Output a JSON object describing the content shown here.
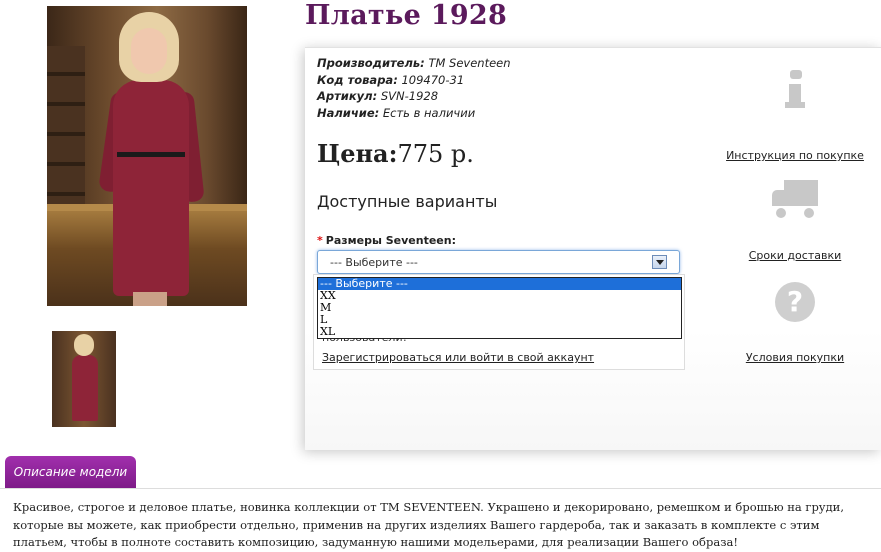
{
  "product": {
    "title": "Платье 1928",
    "manufacturer_label": "Производитель:",
    "manufacturer": "TM Seventeen",
    "code_label": "Код товара:",
    "code": "109470-31",
    "sku_label": "Артикул:",
    "sku": "SVN-1928",
    "availability_label": "Наличие:",
    "availability": "Есть в наличии",
    "price_label": "Цена:",
    "price": "775 р."
  },
  "options": {
    "title": "Доступные варианты",
    "required_mark": "*",
    "size_label": "Размеры Seventeen:",
    "selected": "--- Выберите ---",
    "dropdown": [
      "--- Выберите ---",
      "XX",
      "M",
      "L",
      "XL"
    ]
  },
  "login": {
    "notice": "пользователи!",
    "register_link": "Зарегистрироваться или войти в свой аккаунт"
  },
  "side": {
    "instruction": "Инструкция по покупке",
    "delivery": "Сроки доставки",
    "terms": "Условия покупки"
  },
  "tabs": {
    "description": "Описание модели"
  },
  "description": "Красивое, строгое и деловое платье, новинка коллекции от TM SEVENTEEN. Украшено и декорировано, ремешком и брошью на груди, которые вы можете, как приобрести отдельно, применив на других изделиях Вашего гардероба, так и заказать в комплекте с этим платьем, чтобы в полноте составить композицию, задуманную нашими модельерами, для реализации Вашего образа!",
  "colors": {
    "title": "#5b1a5c",
    "tab": "#8e2098",
    "dropdown_highlight": "#1e6fd9"
  }
}
